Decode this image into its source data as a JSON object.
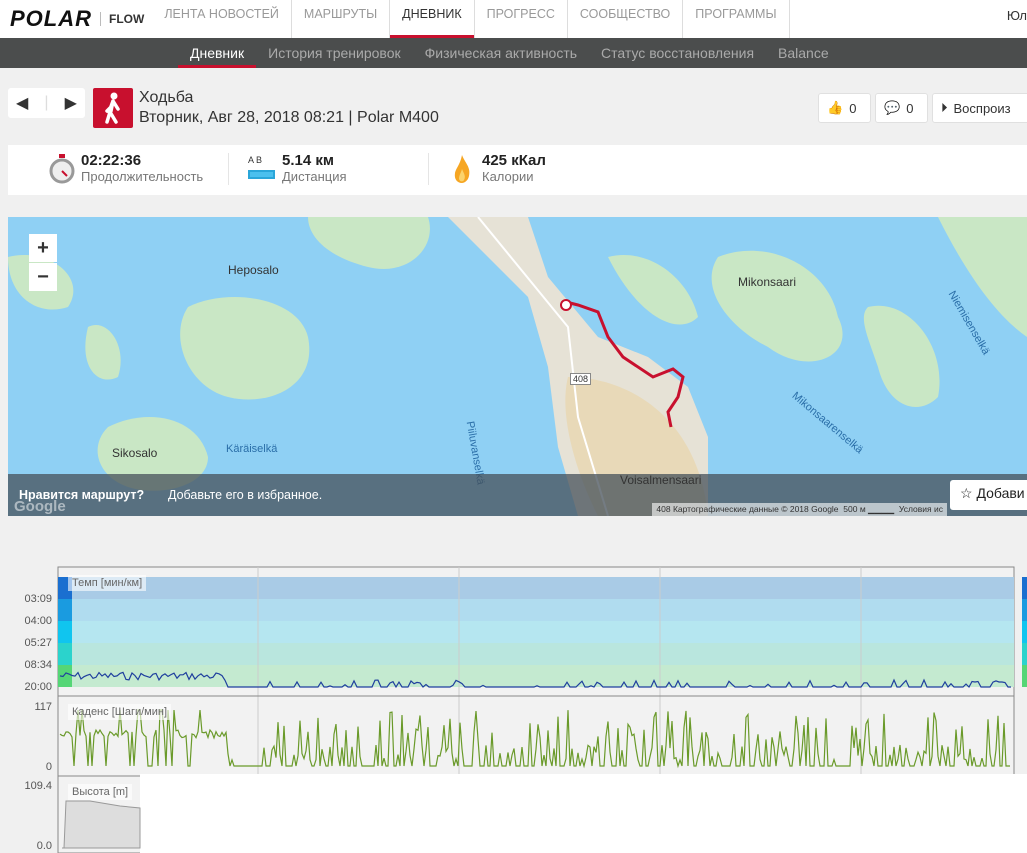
{
  "topnav": {
    "logo": "POLAR",
    "flow": "FLOW",
    "items": [
      "ЛЕНТА НОВОСТЕЙ",
      "МАРШРУТЫ",
      "ДНЕВНИК",
      "ПРОГРЕСС",
      "СООБЩЕСТВО",
      "ПРОГРАММЫ"
    ],
    "user": "Юл"
  },
  "subnav": {
    "items": [
      "Дневник",
      "История тренировок",
      "Физическая активность",
      "Статус восстановления",
      "Balance"
    ]
  },
  "session": {
    "sport": "Ходьба",
    "subtitle": "Вторник, Авг 28, 2018 08:21 | Polar M400",
    "likes": "0",
    "comments": "0",
    "replay": "Воспроиз"
  },
  "stats": {
    "duration": "02:22:36",
    "duration_label": "Продолжительность",
    "distance": "5.14 км",
    "distance_label": "Дистанция",
    "ab": "A  B",
    "calories": "425 кКал",
    "calories_label": "Калории"
  },
  "map": {
    "places": [
      "Heposalo",
      "Mikonsaari",
      "Sikosalo",
      "Käräiselkä",
      "Piiluvanselkä",
      "Voisalmensaari",
      "Mikonsaarenselkä",
      "Niemisenselkä"
    ],
    "road": "408",
    "zoom_in": "+",
    "zoom_out": "−",
    "banner_q": "Нравится маршрут?",
    "banner_text": "Добавьте его в избранное.",
    "fav": "Добави",
    "attribution": "Картографические данные © 2018 Google",
    "scale": "500 м",
    "terms": "Условия ис",
    "google": "Google"
  },
  "charts": {
    "pace": {
      "label": "Темп [мин/км]",
      "ticks": [
        "03:09",
        "04:00",
        "05:27",
        "08:34",
        "20:00"
      ],
      "color": "#1f3f9e"
    },
    "cadence": {
      "label": "Каденс [Шаги/мин]",
      "ticks": [
        "117",
        "0"
      ],
      "color": "#6a9a2a"
    },
    "altitude": {
      "label": "Высота [m]",
      "ticks": [
        "109.4",
        "0.0"
      ]
    }
  }
}
